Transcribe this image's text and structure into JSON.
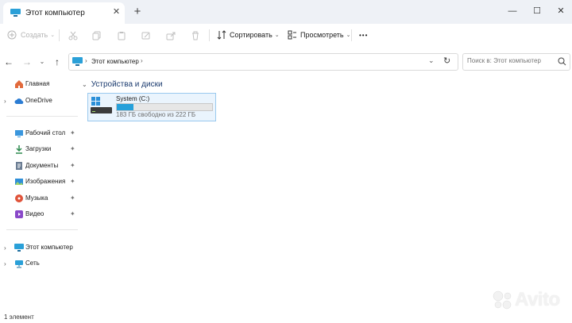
{
  "window": {
    "tab_title": "Этот компьютер",
    "tab_close": "✕",
    "new_tab": "+",
    "minimize": "—",
    "maximize": "☐",
    "close": "✕"
  },
  "toolbar": {
    "create_label": "Создать",
    "sort_label": "Сортировать",
    "view_label": "Просмотреть",
    "more_label": "•••"
  },
  "nav": {
    "breadcrumb_location": "Этот компьютер",
    "search_placeholder": "Поиск в: Этот компьютер"
  },
  "sidebar": {
    "items": [
      {
        "label": "Главная",
        "icon": "home-icon",
        "color": "#e26a3c"
      },
      {
        "label": "OneDrive",
        "icon": "cloud-icon",
        "color": "#2b7cd3"
      },
      {
        "label": "Рабочий стол",
        "icon": "desktop-icon",
        "color": "#3a96dd",
        "pinned": true
      },
      {
        "label": "Загрузки",
        "icon": "download-icon",
        "color": "#2d8a4e",
        "pinned": true
      },
      {
        "label": "Документы",
        "icon": "document-icon",
        "color": "#6b7d93",
        "pinned": true
      },
      {
        "label": "Изображения",
        "icon": "pictures-icon",
        "color": "#2f8fd8",
        "pinned": true
      },
      {
        "label": "Музыка",
        "icon": "music-icon",
        "color": "#e0533a",
        "pinned": true
      },
      {
        "label": "Видео",
        "icon": "video-icon",
        "color": "#8a49c9",
        "pinned": true
      },
      {
        "label": "Этот компьютер",
        "icon": "computer-icon",
        "color": "#2aa0d8"
      },
      {
        "label": "Сеть",
        "icon": "network-icon",
        "color": "#2aa0d8"
      }
    ],
    "pin_glyph": "📌"
  },
  "content": {
    "group_title": "Устройства и диски",
    "drive": {
      "name": "System (C:)",
      "free_text": "183 ГБ свободно из 222 ГБ",
      "used_fraction": 0.176,
      "bar_color": "#26a0da"
    }
  },
  "status": {
    "item_count": "1 элемент"
  },
  "watermark": {
    "text": "Avito"
  }
}
